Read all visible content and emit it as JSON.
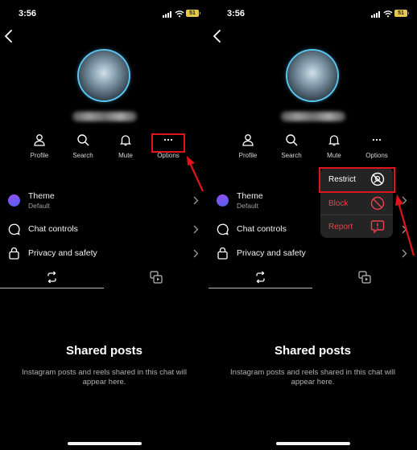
{
  "panels": [
    {
      "status": {
        "time": "3:56",
        "battery": "51"
      },
      "actions": [
        {
          "label": "Profile",
          "icon": "person-icon"
        },
        {
          "label": "Search",
          "icon": "search-icon"
        },
        {
          "label": "Mute",
          "icon": "bell-icon"
        },
        {
          "label": "Options",
          "icon": "more-horizontal-icon"
        }
      ],
      "settings": [
        {
          "title": "Theme",
          "subtitle": "Default",
          "icon": "theme-color-icon"
        },
        {
          "title": "Chat controls",
          "icon": "chat-bubble-icon"
        },
        {
          "title": "Privacy and safety",
          "icon": "lock-icon"
        }
      ],
      "tabs": [
        {
          "icon": "reels-reshare-icon",
          "active": true
        },
        {
          "icon": "media-gallery-icon",
          "active": false
        }
      ],
      "empty": {
        "title": "Shared posts",
        "text": "Instagram posts and reels shared in this chat will appear here."
      }
    },
    {
      "status": {
        "time": "3:56",
        "battery": "51"
      },
      "actions": [
        {
          "label": "Profile",
          "icon": "person-icon"
        },
        {
          "label": "Search",
          "icon": "search-icon"
        },
        {
          "label": "Mute",
          "icon": "bell-icon"
        },
        {
          "label": "Options",
          "icon": "more-horizontal-icon"
        }
      ],
      "settings": [
        {
          "title": "Theme",
          "subtitle": "Default",
          "icon": "theme-color-icon"
        },
        {
          "title": "Chat controls",
          "icon": "chat-bubble-icon"
        },
        {
          "title": "Privacy and safety",
          "icon": "lock-icon"
        }
      ],
      "tabs": [
        {
          "icon": "reels-reshare-icon",
          "active": true
        },
        {
          "icon": "media-gallery-icon",
          "active": false
        }
      ],
      "empty": {
        "title": "Shared posts",
        "text": "Instagram posts and reels shared in this chat will appear here."
      },
      "options_menu": [
        {
          "label": "Restrict",
          "icon": "restrict-icon",
          "color": "#ffffff"
        },
        {
          "label": "Block",
          "icon": "block-icon",
          "color": "#e8414e"
        },
        {
          "label": "Report",
          "icon": "report-icon",
          "color": "#e8414e"
        }
      ]
    }
  ],
  "colors": {
    "annotation": "#e0151b",
    "danger": "#e8414e",
    "background": "#000000",
    "menu_bg": "#242424",
    "avatar_ring": "#5bc4ef"
  }
}
